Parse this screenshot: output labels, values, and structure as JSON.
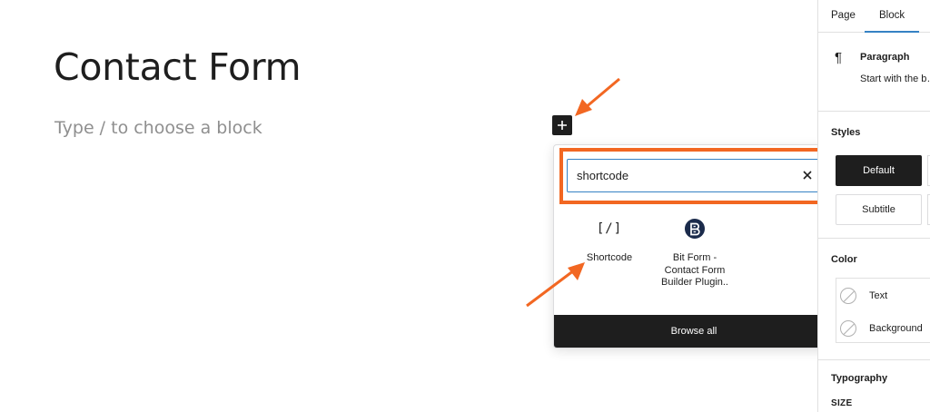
{
  "editor": {
    "title": "Contact Form",
    "placeholder": "Type / to choose a block"
  },
  "inserter": {
    "search_value": "shortcode",
    "results": [
      {
        "label": "Shortcode",
        "icon": "shortcode-icon",
        "glyph": "[/]"
      },
      {
        "label": "Bit Form - Contact Form Builder Plugin..",
        "icon": "bit-form-logo-icon"
      }
    ],
    "browse_all": "Browse all"
  },
  "sidebar": {
    "tabs": [
      "Page",
      "Block"
    ],
    "active_tab": "Block",
    "block": {
      "icon": "paragraph-icon",
      "glyph": "¶",
      "name": "Paragraph",
      "description": "Start with the b… of all narrative."
    },
    "styles": {
      "title": "Styles",
      "options": [
        "Default",
        "Subtitle"
      ],
      "selected": "Default"
    },
    "color": {
      "title": "Color",
      "items": [
        "Text",
        "Background"
      ]
    },
    "typography": {
      "title": "Typography",
      "size_label": "SIZE"
    }
  },
  "colors": {
    "accent": "#3582c4",
    "annotation": "#f26722",
    "dark": "#1e1e1e",
    "placeholder": "#8f8f8f"
  }
}
